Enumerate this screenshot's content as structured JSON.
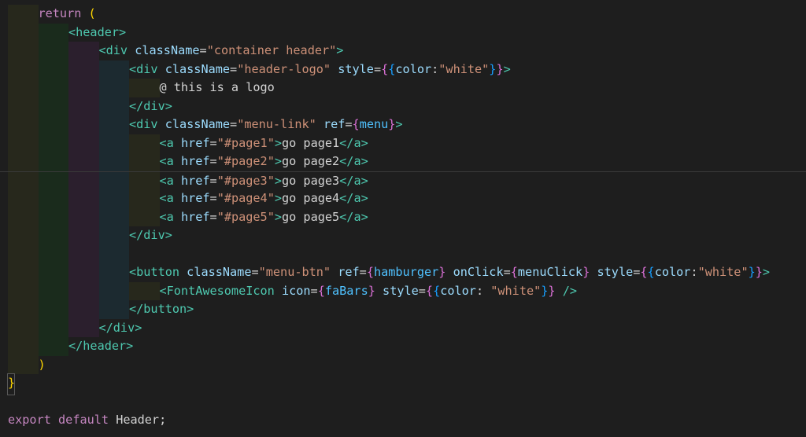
{
  "theme": {
    "background": "#1e1e1e",
    "keyword": "#c586c0",
    "tag": "#4ec9b0",
    "attr": "#9cdcfe",
    "string": "#ce9178",
    "text": "#d4d4d4",
    "var": "#4fc1ff",
    "brace_yellow": "#ffd700",
    "brace_pink": "#da70d6",
    "brace_blue": "#179fff",
    "indent_colors": [
      "#27281c",
      "#1a2b1c",
      "#2b1f2d",
      "#1c2a30"
    ]
  },
  "editor": {
    "lines": [
      {
        "indent": 1,
        "tokens": [
          {
            "t": "return",
            "c": "keyword"
          },
          {
            "t": " ",
            "c": "text"
          },
          {
            "t": "(",
            "c": "brace_yellow"
          }
        ]
      },
      {
        "indent": 2,
        "tokens": [
          {
            "t": "<header>",
            "c": "tag"
          }
        ]
      },
      {
        "indent": 3,
        "tokens": [
          {
            "t": "<div",
            "c": "tag"
          },
          {
            "t": " ",
            "c": "text"
          },
          {
            "t": "className",
            "c": "attr"
          },
          {
            "t": "=",
            "c": "text"
          },
          {
            "t": "\"container header\"",
            "c": "string"
          },
          {
            "t": ">",
            "c": "tag"
          }
        ]
      },
      {
        "indent": 4,
        "tokens": [
          {
            "t": "<div",
            "c": "tag"
          },
          {
            "t": " ",
            "c": "text"
          },
          {
            "t": "className",
            "c": "attr"
          },
          {
            "t": "=",
            "c": "text"
          },
          {
            "t": "\"header-logo\"",
            "c": "string"
          },
          {
            "t": " ",
            "c": "text"
          },
          {
            "t": "style",
            "c": "attr"
          },
          {
            "t": "=",
            "c": "text"
          },
          {
            "t": "{",
            "c": "brace_pink"
          },
          {
            "t": "{",
            "c": "brace_blue"
          },
          {
            "t": "color",
            "c": "attr"
          },
          {
            "t": ":",
            "c": "text"
          },
          {
            "t": "\"white\"",
            "c": "string"
          },
          {
            "t": "}",
            "c": "brace_blue"
          },
          {
            "t": "}",
            "c": "brace_pink"
          },
          {
            "t": ">",
            "c": "tag"
          }
        ]
      },
      {
        "indent": 5,
        "tokens": [
          {
            "t": "@ this is a logo",
            "c": "text"
          }
        ]
      },
      {
        "indent": 4,
        "tokens": [
          {
            "t": "</div>",
            "c": "tag"
          }
        ]
      },
      {
        "indent": 4,
        "tokens": [
          {
            "t": "<div",
            "c": "tag"
          },
          {
            "t": " ",
            "c": "text"
          },
          {
            "t": "className",
            "c": "attr"
          },
          {
            "t": "=",
            "c": "text"
          },
          {
            "t": "\"menu-link\"",
            "c": "string"
          },
          {
            "t": " ",
            "c": "text"
          },
          {
            "t": "ref",
            "c": "attr"
          },
          {
            "t": "=",
            "c": "text"
          },
          {
            "t": "{",
            "c": "brace_pink"
          },
          {
            "t": "menu",
            "c": "var"
          },
          {
            "t": "}",
            "c": "brace_pink"
          },
          {
            "t": ">",
            "c": "tag"
          }
        ]
      },
      {
        "indent": 5,
        "tokens": [
          {
            "t": "<a",
            "c": "tag"
          },
          {
            "t": " ",
            "c": "text"
          },
          {
            "t": "href",
            "c": "attr"
          },
          {
            "t": "=",
            "c": "text"
          },
          {
            "t": "\"#page1\"",
            "c": "string"
          },
          {
            "t": ">",
            "c": "tag"
          },
          {
            "t": "go page1",
            "c": "text"
          },
          {
            "t": "</a>",
            "c": "tag"
          }
        ]
      },
      {
        "indent": 5,
        "tokens": [
          {
            "t": "<a",
            "c": "tag"
          },
          {
            "t": " ",
            "c": "text"
          },
          {
            "t": "href",
            "c": "attr"
          },
          {
            "t": "=",
            "c": "text"
          },
          {
            "t": "\"#page2\"",
            "c": "string"
          },
          {
            "t": ">",
            "c": "tag"
          },
          {
            "t": "go page2",
            "c": "text"
          },
          {
            "t": "</a>",
            "c": "tag"
          }
        ]
      },
      {
        "indent": 5,
        "cursor": true,
        "tokens": [
          {
            "t": "<a",
            "c": "tag"
          },
          {
            "t": " ",
            "c": "text"
          },
          {
            "t": "href",
            "c": "attr"
          },
          {
            "t": "=",
            "c": "text"
          },
          {
            "t": "\"#page3\"",
            "c": "string"
          },
          {
            "t": ">",
            "c": "tag"
          },
          {
            "t": "go page3",
            "c": "text"
          },
          {
            "t": "</a>",
            "c": "tag"
          }
        ]
      },
      {
        "indent": 5,
        "tokens": [
          {
            "t": "<a",
            "c": "tag"
          },
          {
            "t": " ",
            "c": "text"
          },
          {
            "t": "href",
            "c": "attr"
          },
          {
            "t": "=",
            "c": "text"
          },
          {
            "t": "\"#page4\"",
            "c": "string"
          },
          {
            "t": ">",
            "c": "tag"
          },
          {
            "t": "go page4",
            "c": "text"
          },
          {
            "t": "</a>",
            "c": "tag"
          }
        ]
      },
      {
        "indent": 5,
        "tokens": [
          {
            "t": "<a",
            "c": "tag"
          },
          {
            "t": " ",
            "c": "text"
          },
          {
            "t": "href",
            "c": "attr"
          },
          {
            "t": "=",
            "c": "text"
          },
          {
            "t": "\"#page5\"",
            "c": "string"
          },
          {
            "t": ">",
            "c": "tag"
          },
          {
            "t": "go page5",
            "c": "text"
          },
          {
            "t": "</a>",
            "c": "tag"
          }
        ]
      },
      {
        "indent": 4,
        "tokens": [
          {
            "t": "</div>",
            "c": "tag"
          }
        ]
      },
      {
        "indent": 4,
        "tokens": []
      },
      {
        "indent": 4,
        "tokens": [
          {
            "t": "<button",
            "c": "tag"
          },
          {
            "t": " ",
            "c": "text"
          },
          {
            "t": "className",
            "c": "attr"
          },
          {
            "t": "=",
            "c": "text"
          },
          {
            "t": "\"menu-btn\"",
            "c": "string"
          },
          {
            "t": " ",
            "c": "text"
          },
          {
            "t": "ref",
            "c": "attr"
          },
          {
            "t": "=",
            "c": "text"
          },
          {
            "t": "{",
            "c": "brace_pink"
          },
          {
            "t": "hamburger",
            "c": "var"
          },
          {
            "t": "}",
            "c": "brace_pink"
          },
          {
            "t": " ",
            "c": "text"
          },
          {
            "t": "onClick",
            "c": "attr"
          },
          {
            "t": "=",
            "c": "text"
          },
          {
            "t": "{",
            "c": "brace_pink"
          },
          {
            "t": "menuClick",
            "c": "attr"
          },
          {
            "t": "}",
            "c": "brace_pink"
          },
          {
            "t": " ",
            "c": "text"
          },
          {
            "t": "style",
            "c": "attr"
          },
          {
            "t": "=",
            "c": "text"
          },
          {
            "t": "{",
            "c": "brace_pink"
          },
          {
            "t": "{",
            "c": "brace_blue"
          },
          {
            "t": "color",
            "c": "attr"
          },
          {
            "t": ":",
            "c": "text"
          },
          {
            "t": "\"white\"",
            "c": "string"
          },
          {
            "t": "}",
            "c": "brace_blue"
          },
          {
            "t": "}",
            "c": "brace_pink"
          },
          {
            "t": ">",
            "c": "tag"
          }
        ]
      },
      {
        "indent": 5,
        "tokens": [
          {
            "t": "<FontAwesomeIcon",
            "c": "tag"
          },
          {
            "t": " ",
            "c": "text"
          },
          {
            "t": "icon",
            "c": "attr"
          },
          {
            "t": "=",
            "c": "text"
          },
          {
            "t": "{",
            "c": "brace_pink"
          },
          {
            "t": "faBars",
            "c": "var"
          },
          {
            "t": "}",
            "c": "brace_pink"
          },
          {
            "t": " ",
            "c": "text"
          },
          {
            "t": "style",
            "c": "attr"
          },
          {
            "t": "=",
            "c": "text"
          },
          {
            "t": "{",
            "c": "brace_pink"
          },
          {
            "t": "{",
            "c": "brace_blue"
          },
          {
            "t": "color",
            "c": "attr"
          },
          {
            "t": ": ",
            "c": "text"
          },
          {
            "t": "\"white\"",
            "c": "string"
          },
          {
            "t": "}",
            "c": "brace_blue"
          },
          {
            "t": "}",
            "c": "brace_pink"
          },
          {
            "t": " ",
            "c": "text"
          },
          {
            "t": "/>",
            "c": "tag"
          }
        ]
      },
      {
        "indent": 4,
        "tokens": [
          {
            "t": "</button>",
            "c": "tag"
          }
        ]
      },
      {
        "indent": 3,
        "tokens": [
          {
            "t": "</div>",
            "c": "tag"
          }
        ]
      },
      {
        "indent": 2,
        "tokens": [
          {
            "t": "</header>",
            "c": "tag"
          }
        ]
      },
      {
        "indent": 1,
        "tokens": [
          {
            "t": ")",
            "c": "brace_yellow"
          }
        ]
      },
      {
        "indent": 0,
        "tokens": [
          {
            "t": "}",
            "c": "brace_yellow"
          }
        ]
      },
      {
        "indent": 0,
        "tokens": []
      },
      {
        "indent": 0,
        "tokens": [
          {
            "t": "export",
            "c": "keyword"
          },
          {
            "t": " ",
            "c": "text"
          },
          {
            "t": "default",
            "c": "keyword"
          },
          {
            "t": " ",
            "c": "text"
          },
          {
            "t": "Header",
            "c": "text"
          },
          {
            "t": ";",
            "c": "text"
          }
        ]
      }
    ]
  }
}
